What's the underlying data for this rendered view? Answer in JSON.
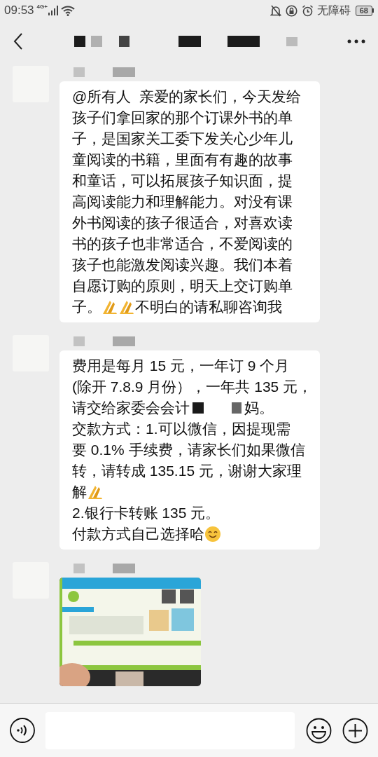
{
  "status_bar": {
    "time": "09:53",
    "network": "4G+",
    "accessibility": "无障碍",
    "battery": "68"
  },
  "messages": [
    {
      "kind": "text",
      "lines": [
        [
          {
            "kind": "text",
            "text": "@所有人  亲爱的家长们，今天发给"
          }
        ],
        [
          {
            "kind": "text",
            "text": "孩子们拿回家的那个订课外书的单"
          }
        ],
        [
          {
            "kind": "text",
            "text": "子，是国家关工委下发关心少年儿"
          }
        ],
        [
          {
            "kind": "text",
            "text": "童阅读的书籍，里面有有趣的故事"
          }
        ],
        [
          {
            "kind": "text",
            "text": "和童话，可以拓展孩子知识面，提"
          }
        ],
        [
          {
            "kind": "text",
            "text": "高阅读能力和理解能力。对没有课"
          }
        ],
        [
          {
            "kind": "text",
            "text": "外书阅读的孩子很适合，对喜欢读"
          }
        ],
        [
          {
            "kind": "text",
            "text": "书的孩子也非常适合，不爱阅读的"
          }
        ],
        [
          {
            "kind": "text",
            "text": "孩子也能激发阅读兴趣。我们本着"
          }
        ],
        [
          {
            "kind": "text",
            "text": "自愿订购的原则，明天上交订购单"
          }
        ],
        [
          {
            "kind": "text",
            "text": "子。"
          },
          {
            "kind": "pray"
          },
          {
            "kind": "pray"
          },
          {
            "kind": "text",
            "text": "不明白的请私聊咨询我"
          }
        ]
      ]
    },
    {
      "kind": "text",
      "lines": [
        [
          {
            "kind": "text",
            "text": "费用是每月 15 元，一年订 9 个月"
          }
        ],
        [
          {
            "kind": "text",
            "text": "(除开 7.8.9 月份），一年共 135 元，"
          }
        ],
        [
          {
            "kind": "text",
            "text": "请交给家委会会计"
          },
          {
            "kind": "redacted"
          },
          {
            "kind": "text",
            "text": "妈。"
          }
        ],
        [
          {
            "kind": "text",
            "text": "交款方式：1.可以微信，因提现需"
          }
        ],
        [
          {
            "kind": "text",
            "text": "要 0.1% 手续费，请家长们如果微信"
          }
        ],
        [
          {
            "kind": "text",
            "text": "转，请转成 135.15 元，谢谢大家理"
          }
        ],
        [
          {
            "kind": "text",
            "text": "解"
          },
          {
            "kind": "pray"
          }
        ],
        [
          {
            "kind": "text",
            "text": "2.银行卡转账 135 元。"
          }
        ],
        [
          {
            "kind": "text",
            "text": "付款方式自己选择哈"
          },
          {
            "kind": "smile"
          }
        ]
      ]
    },
    {
      "kind": "picture"
    }
  ]
}
